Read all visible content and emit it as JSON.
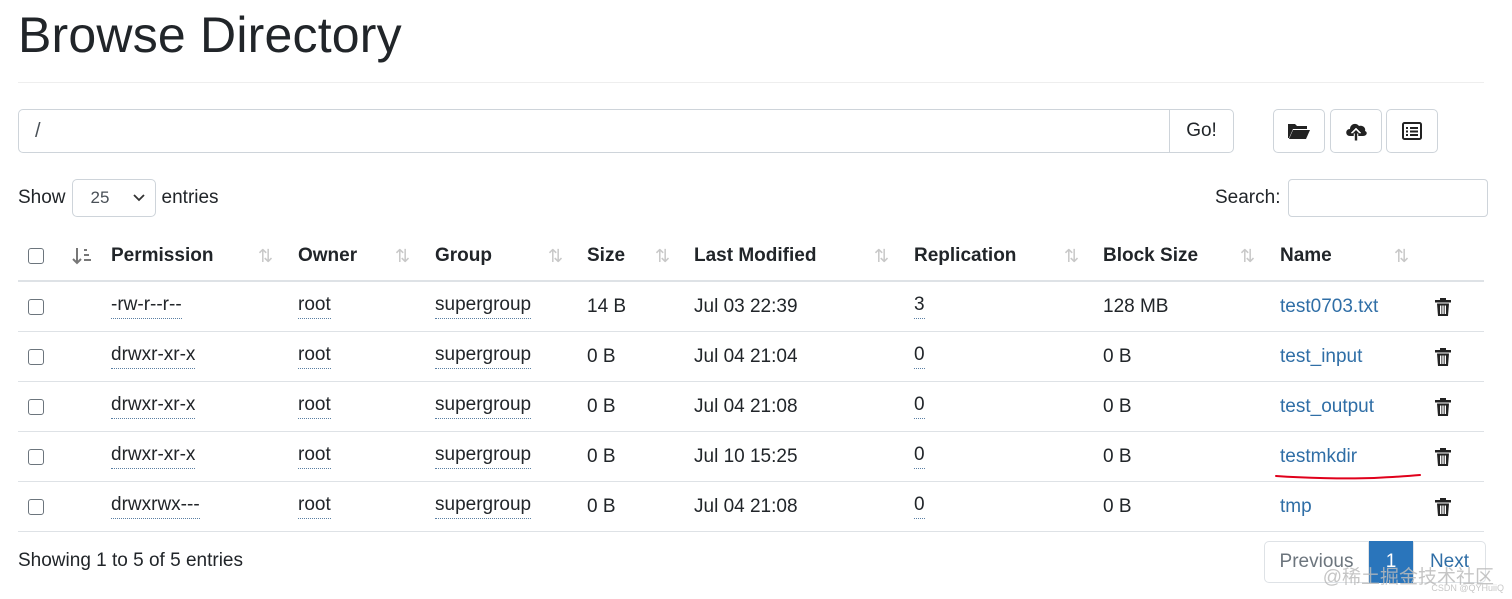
{
  "page": {
    "title": "Browse Directory"
  },
  "path_bar": {
    "value": "/",
    "go_label": "Go!"
  },
  "toolbar": {
    "icons": [
      "folder-open-icon",
      "cloud-upload-icon",
      "list-alt-icon"
    ]
  },
  "length_menu": {
    "show_label": "Show",
    "selected": "25",
    "entries_label": "entries"
  },
  "search": {
    "label": "Search:",
    "value": ""
  },
  "table": {
    "columns": [
      "Permission",
      "Owner",
      "Group",
      "Size",
      "Last Modified",
      "Replication",
      "Block Size",
      "Name"
    ],
    "rows": [
      {
        "permission": "-rw-r--r--",
        "owner": "root",
        "group": "supergroup",
        "size": "14 B",
        "modified": "Jul 03 22:39",
        "replication": "3",
        "block_size": "128 MB",
        "name": "test0703.txt"
      },
      {
        "permission": "drwxr-xr-x",
        "owner": "root",
        "group": "supergroup",
        "size": "0 B",
        "modified": "Jul 04 21:04",
        "replication": "0",
        "block_size": "0 B",
        "name": "test_input"
      },
      {
        "permission": "drwxr-xr-x",
        "owner": "root",
        "group": "supergroup",
        "size": "0 B",
        "modified": "Jul 04 21:08",
        "replication": "0",
        "block_size": "0 B",
        "name": "test_output"
      },
      {
        "permission": "drwxr-xr-x",
        "owner": "root",
        "group": "supergroup",
        "size": "0 B",
        "modified": "Jul 10 15:25",
        "replication": "0",
        "block_size": "0 B",
        "name": "testmkdir"
      },
      {
        "permission": "drwxrwx---",
        "owner": "root",
        "group": "supergroup",
        "size": "0 B",
        "modified": "Jul 04 21:08",
        "replication": "0",
        "block_size": "0 B",
        "name": "tmp"
      }
    ]
  },
  "footer": {
    "info": "Showing 1 to 5 of 5 entries"
  },
  "pagination": {
    "previous": "Previous",
    "current": "1",
    "next": "Next"
  },
  "watermark": {
    "text": "@稀土掘金技术社区",
    "small": "CSDN @QYHuiiQ"
  },
  "colors": {
    "link": "#2f6ea6",
    "active_page": "#2a75bb",
    "annotation": "#e0001b"
  }
}
